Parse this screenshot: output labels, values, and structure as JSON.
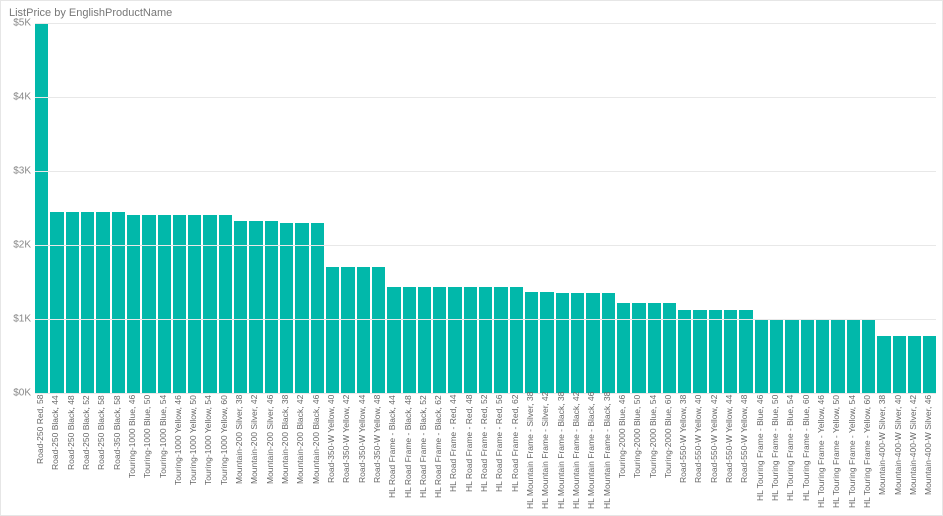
{
  "title": "ListPrice by EnglishProductName",
  "bar_color": "#01b8aa",
  "chart_data": {
    "type": "bar",
    "xlabel": "",
    "ylabel": "",
    "ylim": [
      0,
      5000
    ],
    "yticks": [
      0,
      1000,
      2000,
      3000,
      4000,
      5000
    ],
    "ytick_labels": [
      "$0K",
      "$1K",
      "$2K",
      "$3K",
      "$4K",
      "$5K"
    ],
    "title": "ListPrice by EnglishProductName",
    "categories": [
      "Road-250 Red, 58",
      "Road-250 Black, 44",
      "Road-250 Black, 48",
      "Road-250 Black, 52",
      "Road-250 Black, 58",
      "Road-350 Black, 58",
      "Touring-1000 Blue, 46",
      "Touring-1000 Blue, 50",
      "Touring-1000 Blue, 54",
      "Touring-1000 Yellow, 46",
      "Touring-1000 Yellow, 50",
      "Touring-1000 Yellow, 54",
      "Touring-1000 Yellow, 60",
      "Mountain-200 Silver, 38",
      "Mountain-200 Silver, 42",
      "Mountain-200 Silver, 46",
      "Mountain-200 Black, 38",
      "Mountain-200 Black, 42",
      "Mountain-200 Black, 46",
      "Road-350-W Yellow, 40",
      "Road-350-W Yellow, 42",
      "Road-350-W Yellow, 44",
      "Road-350-W Yellow, 48",
      "HL Road Frame - Black, 44",
      "HL Road Frame - Black, 48",
      "HL Road Frame - Black, 52",
      "HL Road Frame - Black, 62",
      "HL Road Frame - Red, 44",
      "HL Road Frame - Red, 48",
      "HL Road Frame - Red, 52",
      "HL Road Frame - Red, 56",
      "HL Road Frame - Red, 62",
      "HL Mountain Frame - Silver, 38",
      "HL Mountain Frame - Silver, 42",
      "HL Mountain Frame - Black, 38",
      "HL Mountain Frame - Black, 42",
      "HL Mountain Frame - Black, 46",
      "HL Mountain Frame - Black, 38",
      "Touring-2000 Blue, 46",
      "Touring-2000 Blue, 50",
      "Touring-2000 Blue, 54",
      "Touring-2000 Blue, 60",
      "Road-550-W Yellow, 38",
      "Road-550-W Yellow, 40",
      "Road-550-W Yellow, 42",
      "Road-550-W Yellow, 44",
      "Road-550-W Yellow, 48",
      "HL Touring Frame - Blue, 46",
      "HL Touring Frame - Blue, 50",
      "HL Touring Frame - Blue, 54",
      "HL Touring Frame - Blue, 60",
      "HL Touring Frame - Yellow, 46",
      "HL Touring Frame - Yellow, 50",
      "HL Touring Frame - Yellow, 54",
      "HL Touring Frame - Yellow, 60",
      "Mountain-400-W Silver, 38",
      "Mountain-400-W Silver, 40",
      "Mountain-400-W Silver, 42",
      "Mountain-400-W Silver, 46"
    ],
    "values": [
      5000,
      2450,
      2450,
      2450,
      2450,
      2450,
      2400,
      2400,
      2400,
      2400,
      2400,
      2400,
      2400,
      2320,
      2320,
      2320,
      2300,
      2300,
      2300,
      1700,
      1700,
      1700,
      1700,
      1430,
      1430,
      1430,
      1430,
      1430,
      1430,
      1430,
      1430,
      1430,
      1365,
      1365,
      1350,
      1350,
      1350,
      1350,
      1215,
      1215,
      1215,
      1215,
      1120,
      1120,
      1120,
      1120,
      1120,
      1000,
      1000,
      1000,
      1000,
      1000,
      1000,
      1000,
      1000,
      770,
      770,
      770,
      770
    ]
  }
}
